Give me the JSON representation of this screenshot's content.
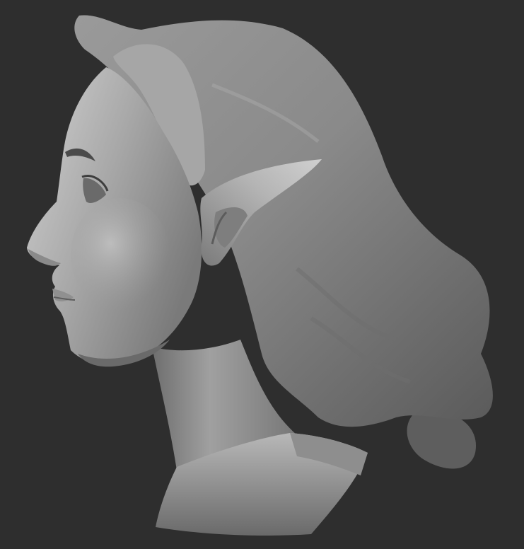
{
  "canvas": {
    "background": "#2e2e2e",
    "material_base": "#8c8c8c",
    "material_highlight": "#d8d8d8",
    "material_shadow": "#3a3a3a"
  },
  "subject": {
    "icon": "elf-bust-sculpt-icon"
  }
}
